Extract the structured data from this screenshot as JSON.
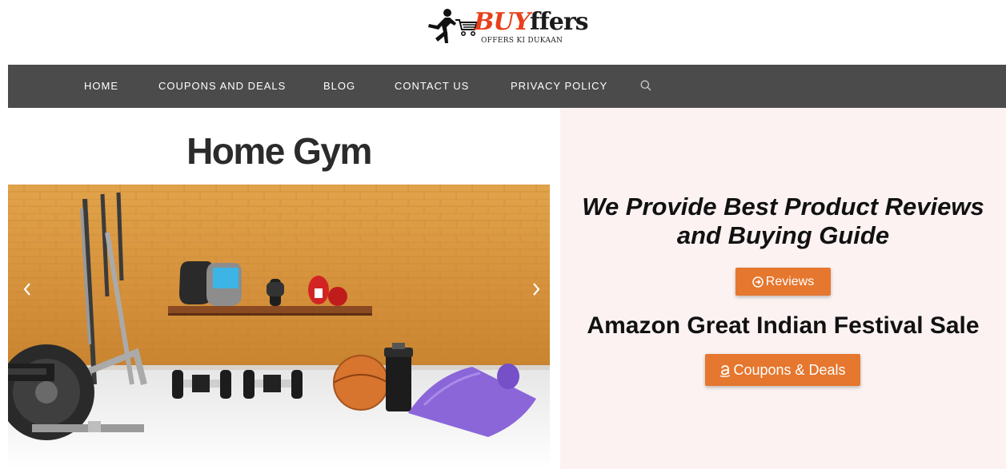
{
  "logo": {
    "brand_highlight": "BUY",
    "brand_rest": "ffers",
    "tagline": "OFFERS KI DUKAAN",
    "brand_color": "#e8401c"
  },
  "nav": {
    "items": [
      {
        "label": "HOME"
      },
      {
        "label": "COUPONS AND DEALS"
      },
      {
        "label": "BLOG"
      },
      {
        "label": "CONTACT US"
      },
      {
        "label": "PRIVACY POLICY"
      }
    ],
    "search_icon": "search-icon",
    "background": "#4b4b4b"
  },
  "slider": {
    "title": "Home Gym",
    "prev_icon": "chevron-left-icon",
    "next_icon": "chevron-right-icon"
  },
  "promo": {
    "heading": "We Provide Best Product Reviews and Buying Guide",
    "reviews_button": "Reviews",
    "reviews_icon": "circle-arrow-right-icon",
    "sale_heading": "Amazon Great Indian Festival Sale",
    "coupons_button": "Coupons & Deals",
    "coupons_icon": "amazon-icon",
    "button_color": "#e5772e",
    "background": "#fcf2f2"
  }
}
